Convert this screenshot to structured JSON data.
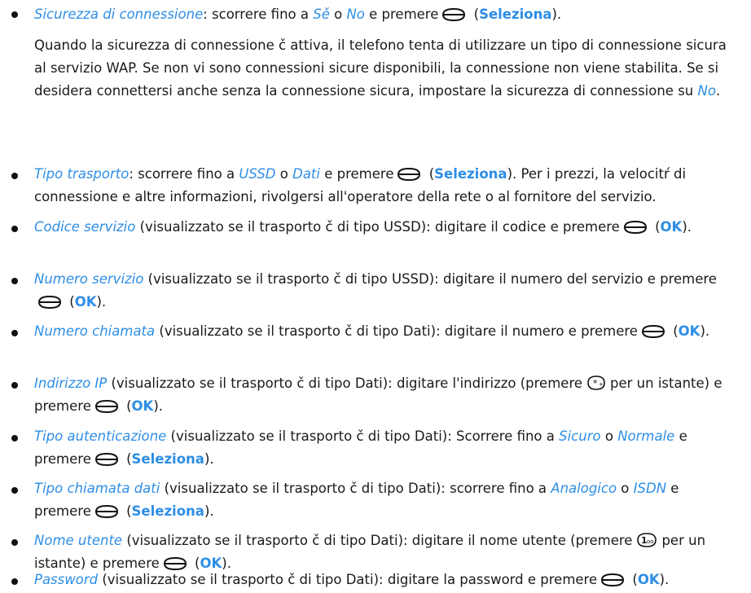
{
  "items": [
    {
      "p1": "Sicurezza di connessione",
      "p2": ": scorrere fino a ",
      "p3": "Sě",
      "p4": " o ",
      "p5": "No",
      "p6": " e premere",
      "key_icon": "navi-key-icon",
      "p7": " (",
      "p8": "Seleziona",
      "p9": ")."
    },
    {
      "note_a": "Quando la sicurezza di connessione č attiva, il telefono tenta di utilizzare un tipo di connessione sicura al servizio WAP. Se non vi sono connessioni sicure disponibili, la connessione non viene stabilita. Se si desidera connettersi anche senza la connessione sicura, impostare la sicurezza di connessione su ",
      "note_b": "No",
      "note_c": "."
    },
    {
      "p1": "Tipo trasporto",
      "p2": ": scorrere fino a ",
      "p3": "USSD",
      "p4": " o ",
      "p5": "Dati",
      "p6": " e premere",
      "p7": " (",
      "p8": "Seleziona",
      "p9": "). Per i prezzi, la velocitŕ di connessione e altre informazioni, rivolgersi all'operatore della rete o al fornitore del servizio."
    },
    {
      "p1": "Codice servizio",
      "p2": " (visualizzato se il trasporto č di tipo USSD): digitare il codice e premere",
      "p3": " (",
      "p4": "OK",
      "p5": ")."
    },
    {
      "p1": "Numero servizio",
      "p2": " (visualizzato se il trasporto č di tipo USSD): digitare il numero del servizio e premere",
      "p3": " (",
      "p4": "OK",
      "p5": ")."
    },
    {
      "p1": "Numero chiamata",
      "p2": " (visualizzato se il trasporto č di tipo Dati): digitare il numero e premere",
      "p3": " (",
      "p4": "OK",
      "p5": ")."
    },
    {
      "p1": "Indirizzo IP",
      "p2": " (visualizzato se il trasporto č di tipo Dati): digitare l'indirizzo (premere",
      "key_icon": "star-key-icon",
      "p3": "per un istante) e premere",
      "p4": " (",
      "p5": "OK",
      "p6": ")."
    },
    {
      "p1": "Tipo autenticazione",
      "p2": " (visualizzato se il trasporto č di tipo Dati): Scorrere fino a ",
      "p3": "Sicuro",
      "p4": " o ",
      "p5": "Normale",
      "p6": " e premere",
      "p7": " (",
      "p8": "Seleziona",
      "p9": ")."
    },
    {
      "p1": "Tipo chiamata dati",
      "p2": " (visualizzato se il trasporto č di tipo Dati): scorrere fino a ",
      "p3": "Analogico",
      "p4": " o ",
      "p5": "ISDN",
      "p6": " e premere",
      "p7": " (",
      "p8": "Seleziona",
      "p9": ")."
    },
    {
      "p1": "Nome utente",
      "p2": " (visualizzato se il trasporto č di tipo Dati): digitare il nome utente (premere",
      "key_icon": "one-key-icon",
      "p3": "per un istante) e premere",
      "p4": " (",
      "p5": "OK",
      "p6": ")."
    },
    {
      "p1": "Password",
      "p2": " (visualizzato se il trasporto č di tipo Dati): digitare la password e premere",
      "p3": " (",
      "p4": "OK",
      "p5": ")."
    }
  ]
}
